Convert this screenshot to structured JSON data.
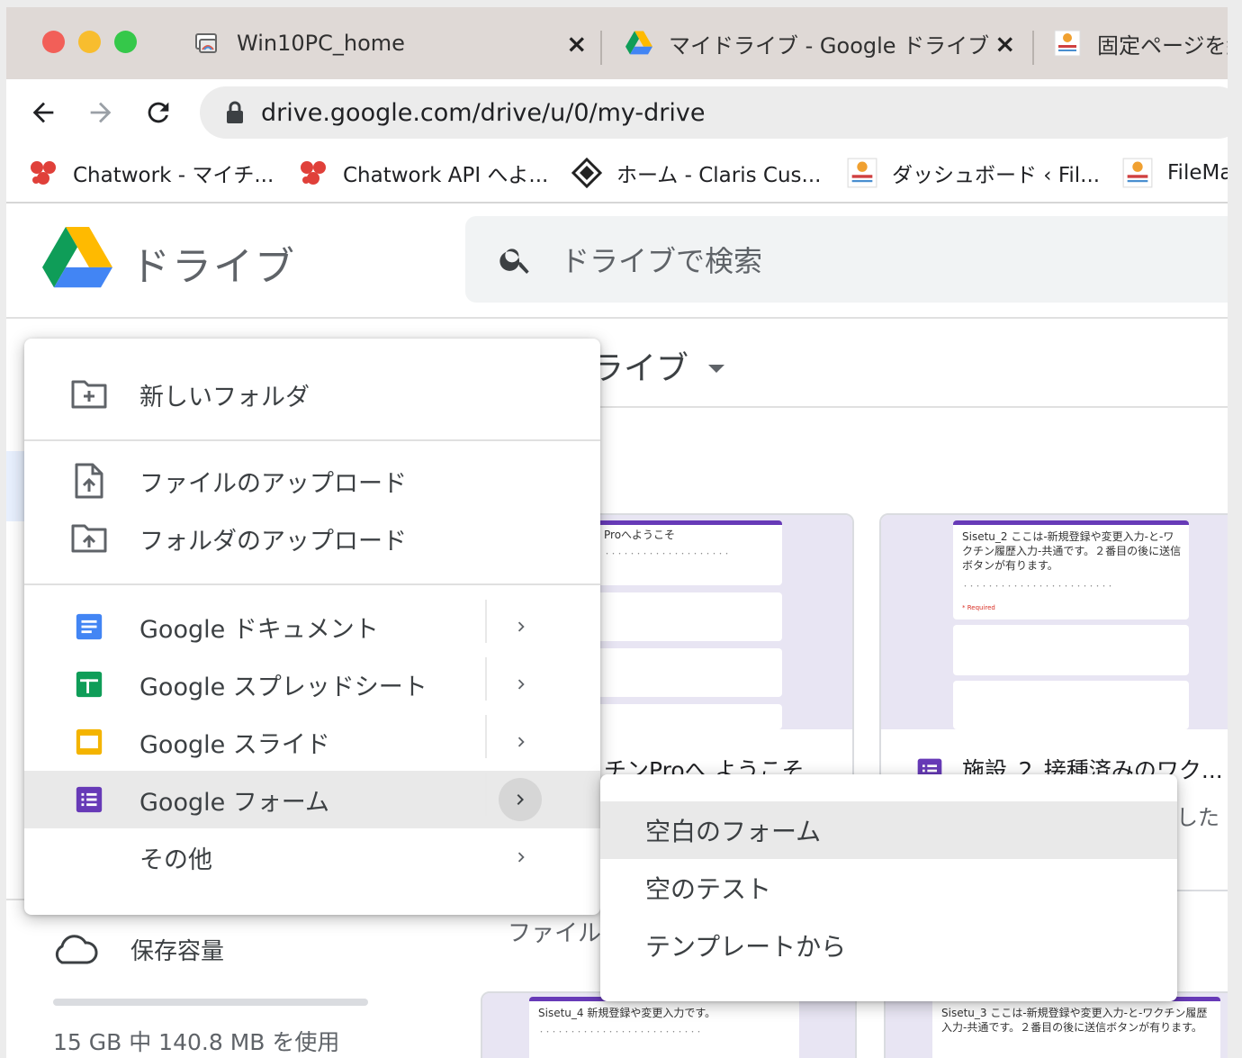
{
  "window": {
    "tabs": [
      {
        "title": "Win10PC_home"
      },
      {
        "title": "マイドライブ - Google ドライブ"
      },
      {
        "title": "固定ページを編"
      }
    ],
    "close_glyph": "×"
  },
  "toolbar": {
    "url": "drive.google.com/drive/u/0/my-drive"
  },
  "bookmarks": [
    {
      "label": "Chatwork - マイチ..."
    },
    {
      "label": "Chatwork API へよ..."
    },
    {
      "label": "ホーム - Claris Cus..."
    },
    {
      "label": "ダッシュボード ‹ Fil..."
    },
    {
      "label": "FileMa"
    }
  ],
  "drive": {
    "app_title": "ドライブ",
    "search_placeholder": "ドライブで検索"
  },
  "background": {
    "breadcrumb_partial": "ライブ",
    "files_label_partial": "ファイル",
    "cards": [
      {
        "thumb_title": "Proへようこそ",
        "label_partial": "チンProへ ようこそ"
      },
      {
        "thumb_title": "Sisetu_2 ここは-新規登録や変更入力-と-ワクチン履歴入力-共通です。２番目の後に送信ボタンが有ります。",
        "required_text": "* Required",
        "label_partial": "施設_2_接種済みのワク..."
      },
      {
        "thumb_title": "Sisetu_4 新規登録や変更入力です。"
      },
      {
        "thumb_title": "Sisetu_3 ここは-新規登録や変更入力-と-ワクチン履歴入力-共通です。２番目の後に送信ボタンが有ります。"
      }
    ],
    "shared_tail": "した"
  },
  "sidebar": {
    "storage_label": "保存容量",
    "storage_used_text": "15 GB 中 140.8 MB を使用",
    "storage_used_fraction": 0.0092
  },
  "new_menu": {
    "items": [
      {
        "label": "新しいフォルダ",
        "icon": "folder-plus-icon"
      },
      {
        "label": "ファイルのアップロード",
        "icon": "file-upload-icon"
      },
      {
        "label": "フォルダのアップロード",
        "icon": "folder-upload-icon"
      },
      {
        "label": "Google ドキュメント",
        "icon": "google-docs-icon"
      },
      {
        "label": "Google スプレッドシート",
        "icon": "google-sheets-icon"
      },
      {
        "label": "Google スライド",
        "icon": "google-slides-icon"
      },
      {
        "label": "Google フォーム",
        "icon": "google-forms-icon"
      },
      {
        "label": "その他"
      }
    ]
  },
  "forms_submenu": {
    "items": [
      {
        "label": "空白のフォーム"
      },
      {
        "label": "空のテスト"
      },
      {
        "label": "テンプレートから"
      }
    ]
  },
  "colors": {
    "docs_blue": "#4285f4",
    "sheets_green": "#0f9d58",
    "slides_yellow": "#f4b400",
    "forms_purple": "#673ab7",
    "drive_green": "#0f9d58",
    "drive_yellow": "#ffba00",
    "drive_blue": "#4285f4"
  }
}
